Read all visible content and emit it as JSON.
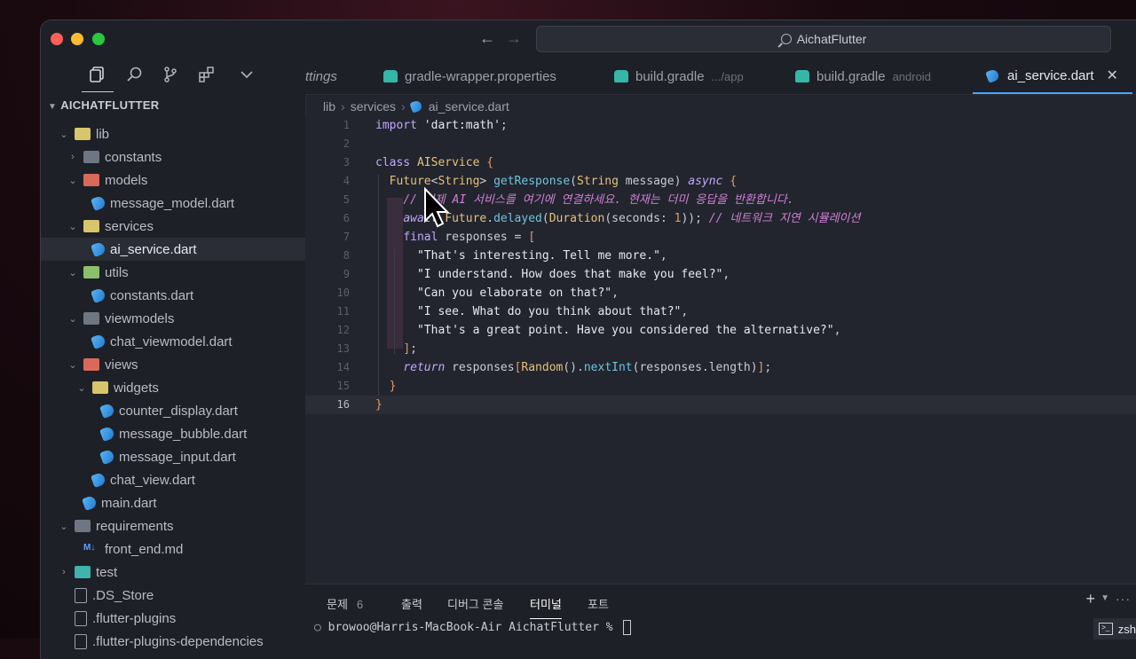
{
  "titlebar": {
    "search": "AichatFlutter"
  },
  "sidebar": {
    "title": "AICHATFLUTTER",
    "tree": [
      {
        "label": "lib",
        "depth": 0,
        "kind": "folder-open",
        "chev": "v"
      },
      {
        "label": "constants",
        "depth": 1,
        "kind": "folder",
        "chev": ">"
      },
      {
        "label": "models",
        "depth": 1,
        "kind": "folder-red",
        "chev": "v"
      },
      {
        "label": "message_model.dart",
        "depth": 2,
        "kind": "dart",
        "chev": ""
      },
      {
        "label": "services",
        "depth": 1,
        "kind": "folder-open",
        "chev": "v"
      },
      {
        "label": "ai_service.dart",
        "depth": 2,
        "kind": "dart",
        "chev": "",
        "selected": true
      },
      {
        "label": "utils",
        "depth": 1,
        "kind": "folder-green",
        "chev": "v"
      },
      {
        "label": "constants.dart",
        "depth": 2,
        "kind": "dart",
        "chev": ""
      },
      {
        "label": "viewmodels",
        "depth": 1,
        "kind": "folder",
        "chev": "v"
      },
      {
        "label": "chat_viewmodel.dart",
        "depth": 2,
        "kind": "dart",
        "chev": ""
      },
      {
        "label": "views",
        "depth": 1,
        "kind": "folder-red",
        "chev": "v"
      },
      {
        "label": "widgets",
        "depth": 2,
        "kind": "folder-open",
        "chev": "v"
      },
      {
        "label": "counter_display.dart",
        "depth": 3,
        "kind": "dart",
        "chev": ""
      },
      {
        "label": "message_bubble.dart",
        "depth": 3,
        "kind": "dart",
        "chev": ""
      },
      {
        "label": "message_input.dart",
        "depth": 3,
        "kind": "dart",
        "chev": ""
      },
      {
        "label": "chat_view.dart",
        "depth": 2,
        "kind": "dart",
        "chev": ""
      },
      {
        "label": "main.dart",
        "depth": 1,
        "kind": "dart",
        "chev": ""
      },
      {
        "label": "requirements",
        "depth": 0,
        "kind": "folder",
        "chev": "v"
      },
      {
        "label": "front_end.md",
        "depth": 1,
        "kind": "md",
        "chev": ""
      },
      {
        "label": "test",
        "depth": 0,
        "kind": "folder-teal",
        "chev": ">"
      },
      {
        "label": ".DS_Store",
        "depth": 0,
        "kind": "file",
        "chev": ""
      },
      {
        "label": ".flutter-plugins",
        "depth": 0,
        "kind": "file",
        "chev": ""
      },
      {
        "label": ".flutter-plugins-dependencies",
        "depth": 0,
        "kind": "file",
        "chev": ""
      }
    ]
  },
  "tabs": {
    "t0": "ttings",
    "t1": "gradle-wrapper.properties",
    "t2": "build.gradle",
    "t2_hint": ".../app",
    "t3": "build.gradle",
    "t3_hint": "android",
    "t4": "ai_service.dart",
    "close": "✕"
  },
  "breadcrumb": {
    "b1": "lib",
    "b2": "services",
    "b3": "ai_service.dart"
  },
  "editor": {
    "line_numbers": {
      "n1": "1",
      "n2": "2",
      "n3": "3",
      "n4": "4",
      "n5": "5",
      "n6": "6",
      "n7": "7",
      "n8": "8",
      "n9": "9",
      "n10": "10",
      "n11": "11",
      "n12": "12",
      "n13": "13",
      "n14": "14",
      "n15": "15",
      "n16": "16"
    }
  },
  "panel": {
    "tabs": {
      "problems": "문제",
      "problems_count": "6",
      "output": "출력",
      "debug": "디버그 콘솔",
      "terminal": "터미널",
      "ports": "포트"
    },
    "prompt": "browoo@Harris-MacBook-Air AichatFlutter % ",
    "shell": "zsh"
  }
}
